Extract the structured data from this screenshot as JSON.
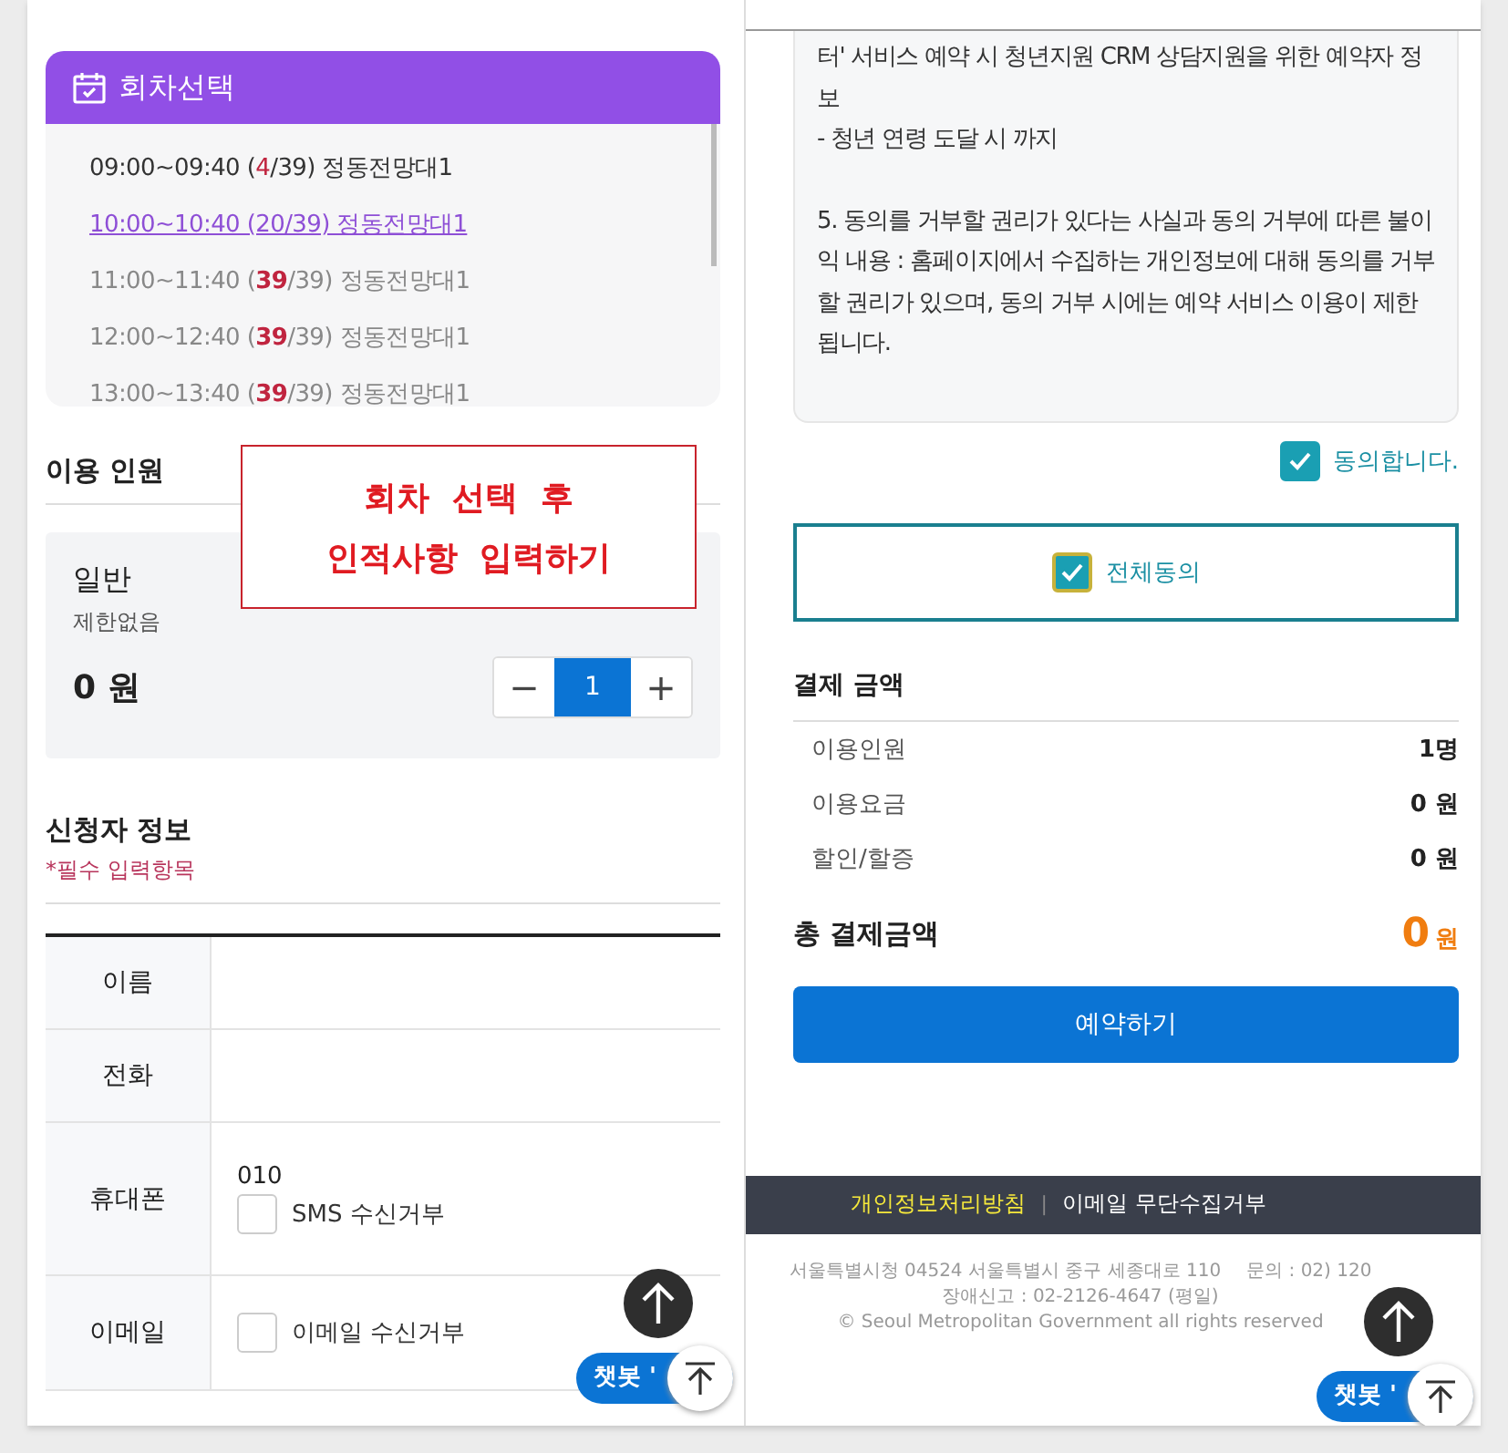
{
  "session_panel": {
    "title": "회차선택",
    "slots": [
      {
        "text": "09:00~09:40 (**4**/39) 정동전망대1",
        "selected": false,
        "full": false
      },
      {
        "text": "10:00~10:40 (20/39) 정동전망대1",
        "selected": true,
        "full": false
      },
      {
        "text": "11:00~11:40 (**39**/39) 정동전망대1",
        "selected": false,
        "full": true
      },
      {
        "text": "12:00~12:40 (**39**/39) 정동전망대1",
        "selected": false,
        "full": true
      },
      {
        "text": "13:00~13:40 (**39**/39) 정동전망대1",
        "selected": false,
        "full": true
      }
    ]
  },
  "annotation": {
    "lines": [
      "회차 선택 후",
      "인적사항 입력하기"
    ]
  },
  "attendees": {
    "title": "이용 인원",
    "type": "일반",
    "limit": "제한없음",
    "price": "0 원",
    "stepper": {
      "minus": "−",
      "value": "1",
      "plus": "+"
    }
  },
  "applicant": {
    "title": "신청자 정보",
    "required_note": "*필수 입력항목",
    "rows": [
      {
        "label": "이름"
      },
      {
        "label": "전화"
      },
      {
        "label": "휴대폰",
        "value": "010",
        "checkbox": {
          "label": "SMS 수신거부",
          "checked": false
        }
      },
      {
        "label": "이메일",
        "checkbox": {
          "label": "이메일 수신거부",
          "checked": false
        }
      }
    ]
  },
  "consent": {
    "lines": [
      "터' 서비스 예약 시 청년지원 CRM 상담지원을 위한 예약자 정보",
      "- 청년 연령 도달 시 까지",
      "5. 동의를 거부할 권리가 있다는 사실과 동의 거부에 따른 불이익 내용 : 홈페이지에서 수집하는 개인정보에 대해 동의를 거부할 권리가 있으며, 동의 거부 시에는 예약 서비스 이용이 제한됩니다."
    ],
    "agree": {
      "label": "동의합니다.",
      "checked": true
    },
    "agree_all": {
      "label": "전체동의",
      "checked": true
    }
  },
  "payment": {
    "title": "결제 금액",
    "items": [
      {
        "label": "이용인원",
        "value": "1명"
      },
      {
        "label": "이용요금",
        "value": "0 원"
      },
      {
        "label": "할인/할증",
        "value": "0 원"
      }
    ],
    "total_label": "총 결제금액",
    "total_amount": "0",
    "total_unit": "원",
    "button": "예약하기"
  },
  "footer": {
    "separator": "|",
    "links": [
      {
        "label": "개인정보처리방침",
        "highlight": true
      },
      {
        "label": "이메일 무단수집거부",
        "highlight": false
      }
    ],
    "address": "서울특별시청 04524 서울특별시 중구 세종대로 110",
    "contact": "문의 : 02) 120",
    "report": "장애신고 : 02-2126-4647 (평일)",
    "copyright": "© Seoul Metropolitan Government all rights reserved"
  },
  "floating": {
    "chatbot_left": "챗봇 '",
    "chatbot_right": "챗봇 '"
  }
}
